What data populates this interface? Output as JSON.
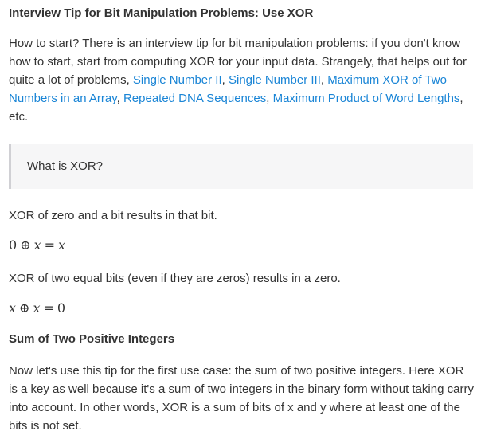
{
  "section1": {
    "title": "Interview Tip for Bit Manipulation Problems: Use XOR",
    "intro": {
      "text_before": "How to start? There is an interview tip for bit manipulation problems: if you don't know how to start, start from computing XOR for your input data. Strangely, that helps out for quite a lot of problems, ",
      "link1": "Single Number II",
      "sep1": ", ",
      "link2": "Single Number III",
      "sep2": ", ",
      "link3": "Maximum XOR of Two Numbers in an Array",
      "sep3": ", ",
      "link4": "Repeated DNA Sequences",
      "sep4": ", ",
      "link5": "Maximum Product of Word Lengths",
      "text_after": ", etc."
    },
    "callout": "What is XOR?",
    "xor_zero_text": "XOR of zero and a bit results in that bit.",
    "formula1": {
      "a": "0",
      "op": "⊕",
      "b": "x",
      "eq": "=",
      "c": "x"
    },
    "xor_equal_text": "XOR of two equal bits (even if they are zeros) results in a zero.",
    "formula2": {
      "a": "x",
      "op": "⊕",
      "b": "x",
      "eq": "=",
      "c": "0"
    }
  },
  "section2": {
    "title": "Sum of Two Positive Integers",
    "body": "Now let's use this tip for the first use case: the sum of two positive integers. Here XOR is a key as well because it's a sum of two integers in the binary form without taking carry into account. In other words, XOR is a sum of bits of x and y where at least one of the bits is not set."
  },
  "colors": {
    "text": "#333333",
    "link": "#1a85d6",
    "callout_bg": "#f6f6f7",
    "callout_border": "#d0d0d4"
  }
}
